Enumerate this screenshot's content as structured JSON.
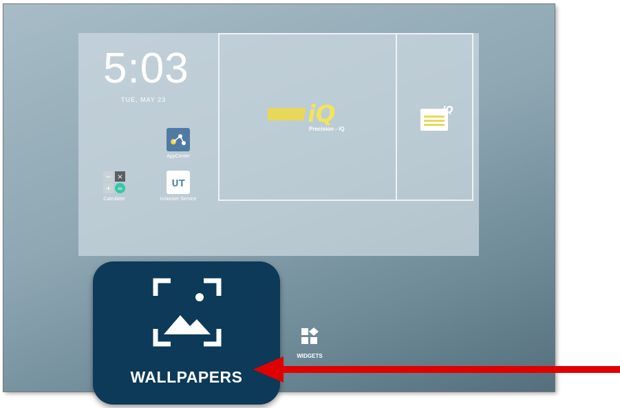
{
  "lock_screen": {
    "time": "5:03",
    "date": "TUE, MAY 23"
  },
  "apps": [
    {
      "label": "AppCenter"
    },
    {
      "label": "Calculator"
    },
    {
      "label": "Unlocker Service"
    }
  ],
  "widget_panel": {
    "brand_text": "iQ",
    "product_name": "Precision - iQ"
  },
  "bottom_menu": {
    "wallpapers_label": "WALLPAPERS",
    "widgets_label": "WIDGETS"
  },
  "colors": {
    "accent_card": "#0c3a58",
    "arrow": "#e00000"
  },
  "icons": {
    "wallpaper": "image-frame-icon",
    "widgets": "widgets-grid-icon",
    "calculator": "calculator-icon",
    "app_center": "app-center-icon",
    "unlock": "unlocker-icon"
  }
}
